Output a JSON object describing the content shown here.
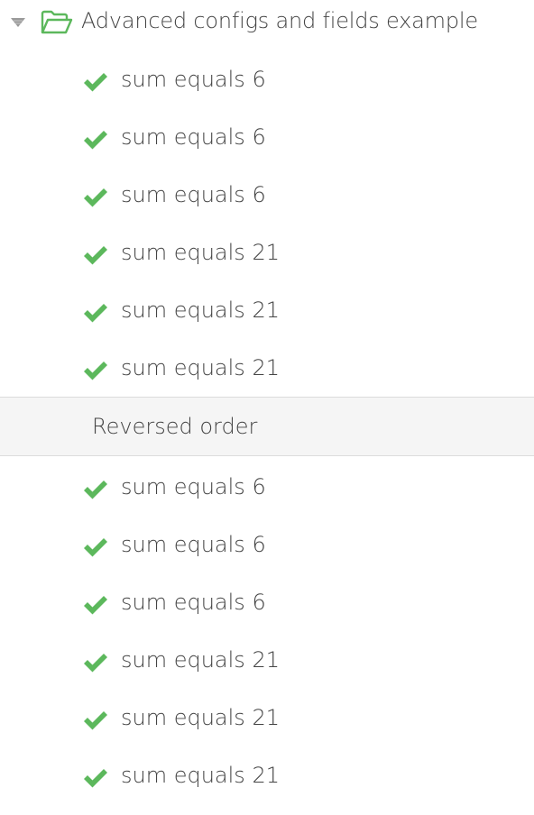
{
  "suite": {
    "title": "Advanced configs and fields example",
    "toggle_icon": "triangle-down-icon",
    "folder_icon": "folder-open-icon",
    "folder_color": "#5cb85c"
  },
  "group_one": {
    "tests": [
      {
        "label": "sum equals 6",
        "status": "passed"
      },
      {
        "label": "sum equals 6",
        "status": "passed"
      },
      {
        "label": "sum equals 6",
        "status": "passed"
      },
      {
        "label": "sum equals 21",
        "status": "passed"
      },
      {
        "label": "sum equals 21",
        "status": "passed"
      },
      {
        "label": "sum equals 21",
        "status": "passed"
      }
    ]
  },
  "section": {
    "title": "Reversed order"
  },
  "group_two": {
    "tests": [
      {
        "label": "sum equals 6",
        "status": "passed"
      },
      {
        "label": "sum equals 6",
        "status": "passed"
      },
      {
        "label": "sum equals 6",
        "status": "passed"
      },
      {
        "label": "sum equals 21",
        "status": "passed"
      },
      {
        "label": "sum equals 21",
        "status": "passed"
      },
      {
        "label": "sum equals 21",
        "status": "passed"
      }
    ]
  },
  "colors": {
    "pass": "#5cb85c",
    "text": "#444444",
    "section_bg": "#f5f5f5"
  }
}
